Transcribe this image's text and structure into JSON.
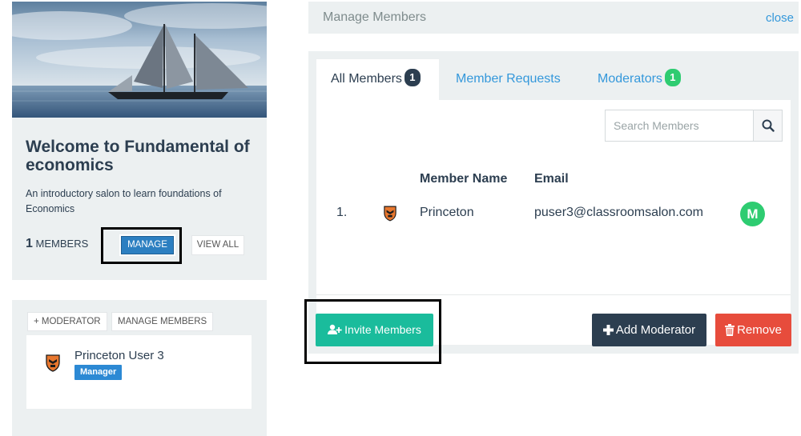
{
  "salon": {
    "title": "Welcome to Fundamental of economics",
    "description": "An introductory salon to learn foundations of Economics",
    "member_count": "1",
    "members_label": "MEMBERS",
    "manage_label": "MANAGE",
    "view_all_label": "VIEW ALL"
  },
  "moderators_card": {
    "add_moderator_label": "+ MODERATOR",
    "manage_members_label": "MANAGE MEMBERS",
    "user_name": "Princeton User 3",
    "user_role": "Manager"
  },
  "manage_members": {
    "title": "Manage Members",
    "close_label": "close",
    "tabs": [
      {
        "label": "All Members",
        "badge": "1"
      },
      {
        "label": "Member Requests"
      },
      {
        "label": "Moderators",
        "badge": "1"
      }
    ],
    "search_placeholder": "Search Members",
    "columns": {
      "name": "Member Name",
      "email": "Email"
    },
    "rows": [
      {
        "number": "1.",
        "name": "Princeton",
        "email": "puser3@classroomsalon.com",
        "role_initial": "M"
      }
    ],
    "buttons": {
      "invite": "Invite Members",
      "add_moderator": "Add Moderator",
      "remove": "Remove"
    }
  },
  "colors": {
    "manage_button": "#2c7fc1",
    "badge_dark": "#2c3e50",
    "badge_green": "#2ecc71",
    "invite_button": "#1abc9c",
    "add_moderator_button": "#2c3e50",
    "remove_button": "#e74c3c",
    "link": "#3498db",
    "highlight_box": "#000000"
  },
  "icons": {
    "search": "search-icon",
    "invite": "user-plus-icon",
    "add_moderator": "plus-icon",
    "remove": "trash-icon",
    "logo": "princeton-shield-icon"
  }
}
